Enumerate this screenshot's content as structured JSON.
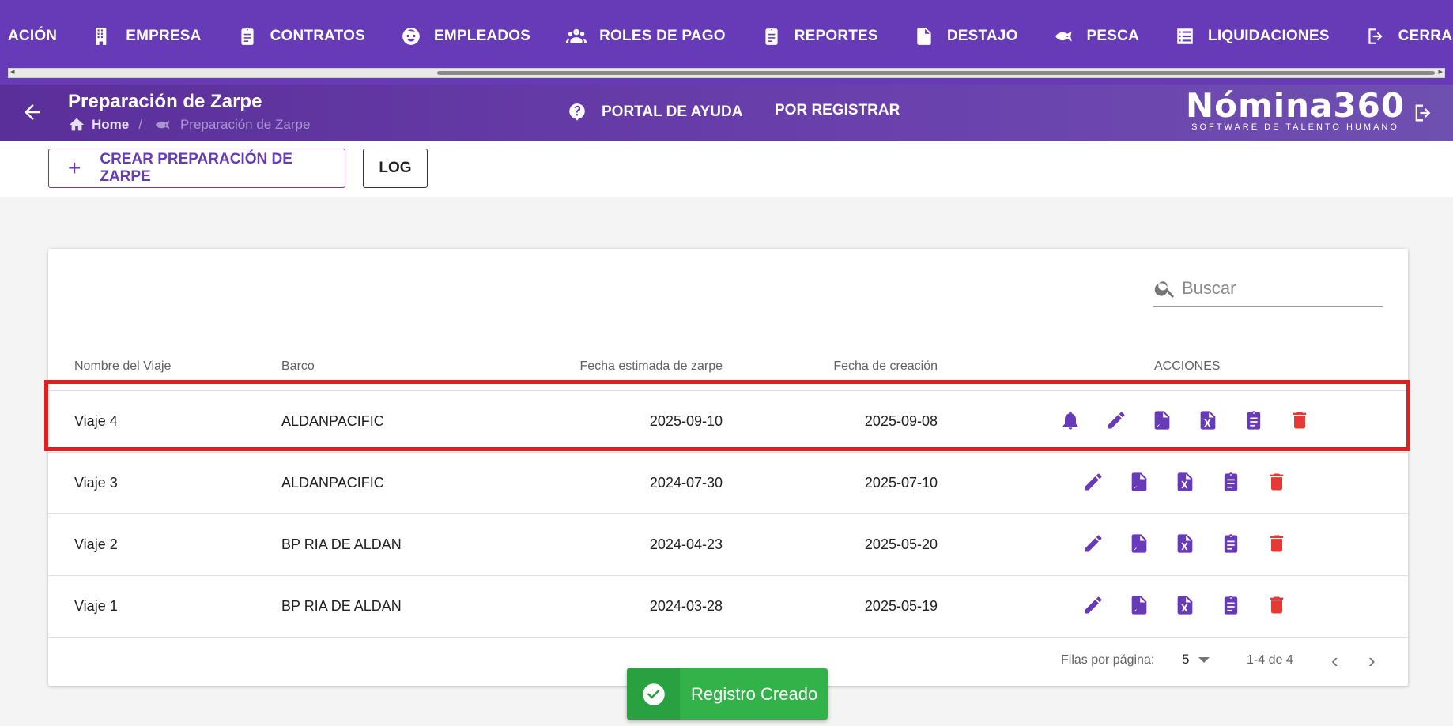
{
  "nav": {
    "items": [
      {
        "label": "ACIÓN",
        "icon": ""
      },
      {
        "label": "EMPRESA",
        "icon": "building-icon"
      },
      {
        "label": "CONTRATOS",
        "icon": "clipboard-icon"
      },
      {
        "label": "EMPLEADOS",
        "icon": "face-icon"
      },
      {
        "label": "ROLES DE PAGO",
        "icon": "group-icon"
      },
      {
        "label": "REPORTES",
        "icon": "report-icon"
      },
      {
        "label": "DESTAJO",
        "icon": "document-icon"
      },
      {
        "label": "PESCA",
        "icon": "fish-icon"
      },
      {
        "label": "LIQUIDACIONES",
        "icon": "list-icon"
      },
      {
        "label": "CERRAR SESIÓN",
        "icon": "logout-icon"
      }
    ]
  },
  "header": {
    "title": "Preparación de Zarpe",
    "breadcrumb": {
      "home": "Home",
      "separator": "/",
      "current": "Preparación de Zarpe"
    },
    "help_link": "PORTAL DE AYUDA",
    "register_link": "POR REGISTRAR",
    "logo_main": "Nómina360",
    "logo_sub": "SOFTWARE DE TALENTO HUMANO"
  },
  "toolbar": {
    "create_icon": "+",
    "create_label": "CREAR PREPARACIÓN DE ZARPE",
    "log_label": "LOG"
  },
  "table": {
    "search_placeholder": "Buscar",
    "columns": [
      "Nombre del Viaje",
      "Barco",
      "Fecha estimada de zarpe",
      "Fecha de creación",
      "ACCIONES"
    ],
    "rows": [
      {
        "nombre": "Viaje 4",
        "barco": "ALDANPACIFIC",
        "fecha_zarpe": "2025-09-10",
        "fecha_creacion": "2025-09-08",
        "has_bell": true
      },
      {
        "nombre": "Viaje 3",
        "barco": "ALDANPACIFIC",
        "fecha_zarpe": "2024-07-30",
        "fecha_creacion": "2025-07-10",
        "has_bell": false
      },
      {
        "nombre": "Viaje 2",
        "barco": "BP RIA DE ALDAN",
        "fecha_zarpe": "2024-04-23",
        "fecha_creacion": "2025-05-20",
        "has_bell": false
      },
      {
        "nombre": "Viaje 1",
        "barco": "BP RIA DE ALDAN",
        "fecha_zarpe": "2024-03-28",
        "fecha_creacion": "2025-05-19",
        "has_bell": false
      }
    ],
    "pagination": {
      "rows_per_page_label": "Filas por página:",
      "rows_per_page": "5",
      "range": "1-4 de 4",
      "prev": "‹",
      "next": "›"
    }
  },
  "toast": {
    "message": "Registro Creado"
  },
  "colors": {
    "primary": "#673ab7",
    "danger": "#e53935",
    "success": "#33b249",
    "highlight": "#e02020"
  }
}
